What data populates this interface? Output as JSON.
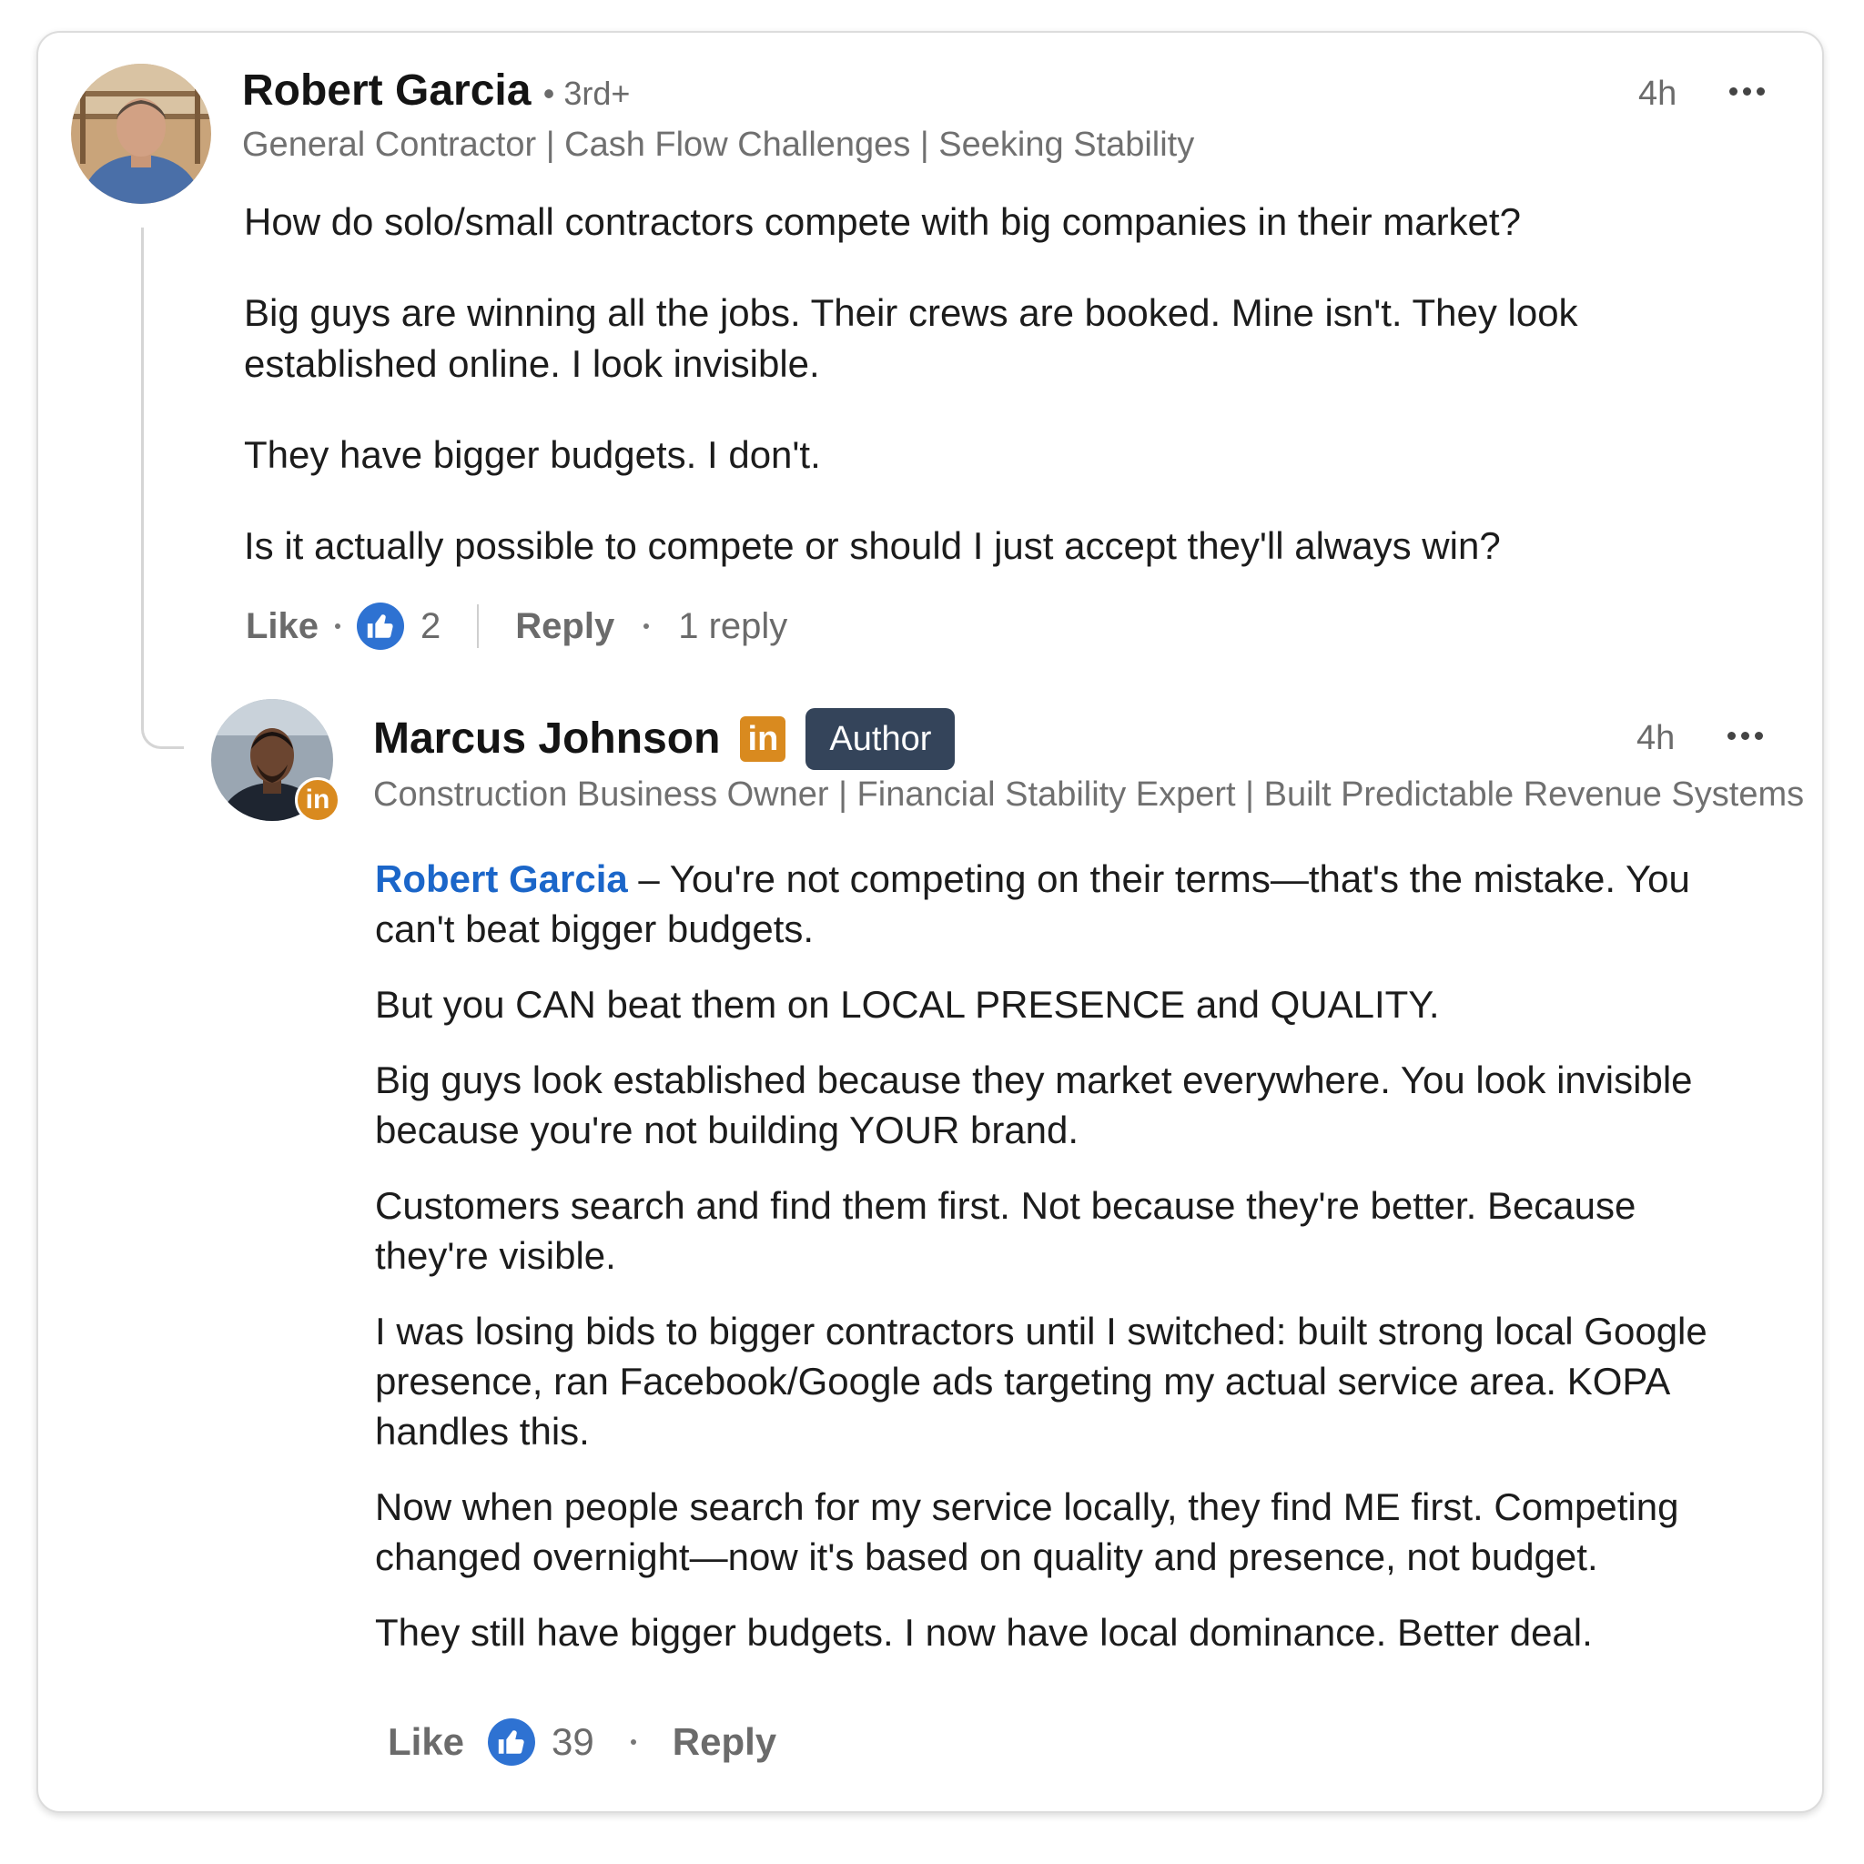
{
  "colors": {
    "mention": "#1b66c9",
    "like": "#2e72d2",
    "linkedin_badge": "#d98a1f",
    "author_tag": "#34445a"
  },
  "comment": {
    "author": "Robert Garcia",
    "degree": "3rd+",
    "headline": "General Contractor | Cash Flow Challenges | Seeking Stability",
    "time": "4h",
    "paragraphs": [
      "How do solo/small contractors compete with big companies in their market?",
      "Big guys are winning all the jobs. Their crews are booked. Mine isn't. They look established online. I look invisible.",
      "They have bigger budgets. I don't.",
      "Is it actually possible to compete or should I just accept they'll always win?"
    ],
    "like_label": "Like",
    "like_count": "2",
    "reply_label": "Reply",
    "reply_count": "1 reply",
    "icons": {
      "avatar": "avatar-photo",
      "more": "more-icon",
      "like": "thumbs-up-icon"
    }
  },
  "reply": {
    "author": "Marcus Johnson",
    "linkedin_badge": "in",
    "author_tag": "Author",
    "headline": "Construction Business Owner | Financial Stability Expert | Built Predictable Revenue Systems",
    "time": "4h",
    "mention": "Robert Garcia",
    "first_paragraph": " – You're not competing on their terms—that's the mistake. You can't beat bigger budgets.",
    "paragraphs": [
      "But you CAN beat them on LOCAL PRESENCE and QUALITY.",
      "Big guys look established because they market everywhere. You look invisible because you're not building YOUR brand.",
      "Customers search and find them first. Not because they're better. Because they're visible.",
      "I was losing bids to bigger contractors until I switched: built strong local Google presence, ran Facebook/Google ads targeting my actual service area. KOPA handles this.",
      "Now when people search for my service locally, they find ME first. Competing changed overnight—now it's based on quality and presence, not budget.",
      "They still have bigger budgets. I now have local dominance. Better deal."
    ],
    "like_label": "Like",
    "like_count": "39",
    "reply_label": "Reply",
    "icons": {
      "avatar": "avatar-photo",
      "more": "more-icon",
      "like": "thumbs-up-icon",
      "badge": "linkedin-icon"
    }
  }
}
